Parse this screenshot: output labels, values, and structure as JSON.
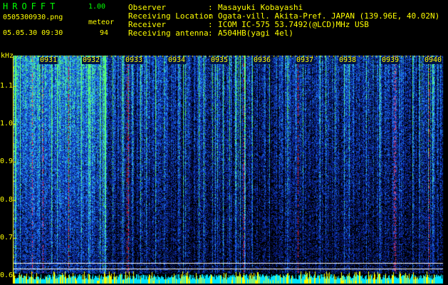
{
  "app": {
    "logo_text": "HROFFT",
    "version": "1.00",
    "filename": "0505300930.png",
    "datetime": "05.05.30 09:30",
    "counter_label": "meteor",
    "counter_value": "94"
  },
  "info": {
    "rows": [
      {
        "label": "Observer",
        "sep": ":",
        "value": "Masayuki Kobayashi"
      },
      {
        "label": "Receiving Location",
        "sep": ":",
        "value": "Ogata-vill. Akita-Pref. JAPAN (139.96E, 40.02N)"
      },
      {
        "label": "Receiver",
        "sep": ":",
        "value": "ICOM IC-575 53.7492(@LCD)MHz USB"
      },
      {
        "label": "Receiving antenna",
        "sep": ":",
        "value": "A504HB(yagi 4el)"
      }
    ]
  },
  "chart_data": {
    "type": "heatmap",
    "ylabel": "kHz",
    "y_ticks": [
      "1.1",
      "1.0",
      "0.9",
      "0.8",
      "0.7",
      "0.6"
    ],
    "ylim": [
      0.58,
      1.18
    ],
    "x_ticks": [
      "0931",
      "0932",
      "0933",
      "0934",
      "0935",
      "0936",
      "0937",
      "0938",
      "0939",
      "0940"
    ],
    "colors": {
      "background": "#000000",
      "noise_low": "#0a1e8c",
      "noise_mid": "#1e78ff",
      "hot": "#3cff64",
      "trace": "#ff3050",
      "axis": "#ffff00",
      "overlay_line": "#ffffff",
      "baseline": "#00e5ff"
    }
  }
}
